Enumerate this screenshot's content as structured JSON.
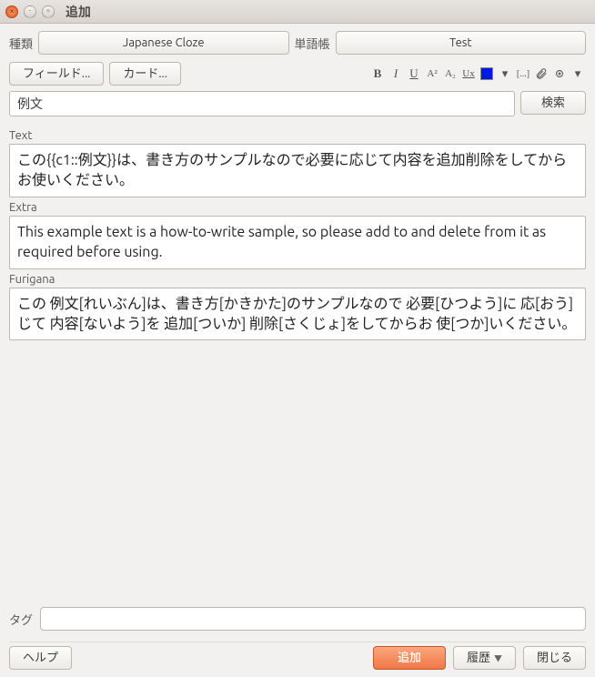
{
  "window": {
    "title": "追加"
  },
  "selectors": {
    "type_label": "種類",
    "type_value": "Japanese Cloze",
    "deck_label": "単語帳",
    "deck_value": "Test"
  },
  "toolbar": {
    "fields_btn": "フィールド...",
    "cards_btn": "カード..."
  },
  "format": {
    "bold": "B",
    "italic": "I",
    "underline": "U",
    "sup": "A²",
    "sub": "A₂",
    "clear": "Ux",
    "color_hex": "#0018e4",
    "cloze": "[...]"
  },
  "search": {
    "value": "例文",
    "button": "検索"
  },
  "fields": [
    {
      "name": "Text",
      "value": "この{{c1::例文}}は、書き方のサンプルなので必要に応じて内容を追加削除をしてからお使いください。"
    },
    {
      "name": "Extra",
      "value": "This example text is a how-to-write sample, so please add to and delete from it as required before using."
    },
    {
      "name": "Furigana",
      "value": "この 例文[れいぶん]は、書き方[かきかた]のサンプルなので 必要[ひつよう]に 応[おう]じて 内容[ないよう]を 追加[ついか] 削除[さくじょ]をしてからお 使[つか]いください。"
    }
  ],
  "tags": {
    "label": "タグ",
    "value": ""
  },
  "footer": {
    "help": "ヘルプ",
    "add": "追加",
    "history": "履歴",
    "close": "閉じる"
  }
}
